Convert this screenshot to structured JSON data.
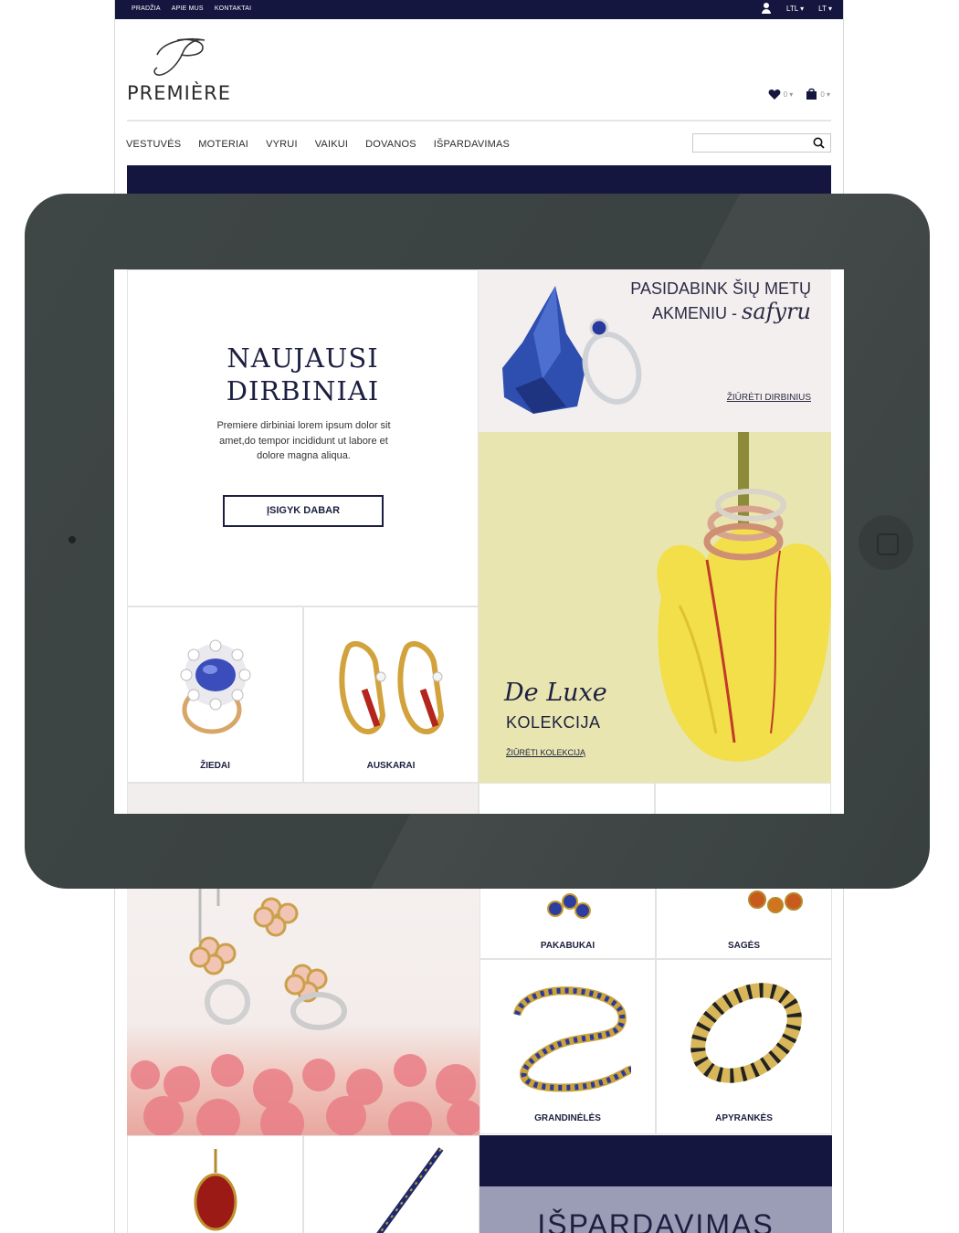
{
  "topbar": {
    "links": [
      "PRADŽIA",
      "APIE MUS",
      "KONTAKTAI"
    ],
    "currency": "LTL ▾",
    "language": "LT ▾"
  },
  "brand": {
    "name": "PREMIÈRE"
  },
  "header": {
    "wishlist_count": "0 ▾",
    "cart_count": "0 ▾"
  },
  "nav": {
    "items": [
      "VESTUVĖS",
      "MOTERIAI",
      "VYRUI",
      "VAIKUI",
      "DOVANOS",
      "IŠPARDAVIMAS"
    ],
    "search_placeholder": ""
  },
  "hero": {
    "title_line1": "NAUJAUSI",
    "title_line2": "DIRBINIAI",
    "text": "Premiere dirbiniai lorem ipsum dolor sit amet,do tempor incididunt ut labore et dolore magna aliqua.",
    "button": "ĮSIGYK DABAR"
  },
  "sapphire": {
    "line1": "PASIDABINK ŠIŲ METŲ",
    "line2_prefix": "AKMENIU - ",
    "line2_script": "safyru",
    "link": "ŽIŪRĖTI DIRBINIUS"
  },
  "deluxe": {
    "script": "De Luxe",
    "title": "KOLEKCIJA",
    "link": "ŽIŪRĖTI KOLEKCIJĄ"
  },
  "categories": {
    "rings": "ŽIEDAI",
    "earrings": "AUSKARAI",
    "pendants": "PAKABUKAI",
    "brooches": "SAGĖS",
    "chains": "GRANDINĖLĖS",
    "bracelets": "APYRANKĖS"
  },
  "sale": {
    "title": "IŠPARDAVIMAS"
  },
  "colors": {
    "navy": "#14163f",
    "tablet": "#3a4141",
    "sapphire_bg": "#f4efef",
    "deluxe_bg": "#e8e5b1"
  }
}
